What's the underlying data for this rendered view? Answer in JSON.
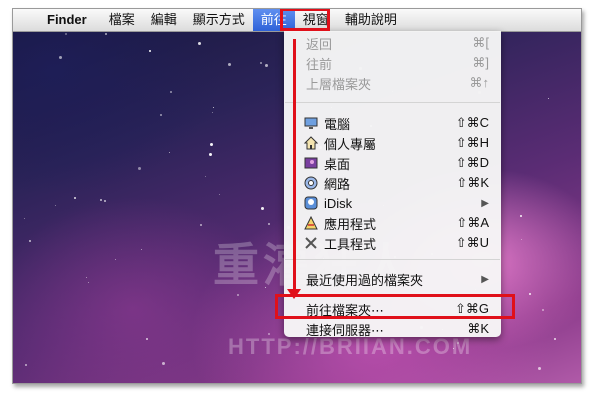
{
  "menubar": {
    "apple": "",
    "items": [
      "Finder",
      "檔案",
      "編輯",
      "顯示方式",
      "前往",
      "視窗",
      "輔助說明"
    ]
  },
  "menu": {
    "items": [
      {
        "label": "返回",
        "shortcut": "⌘[",
        "disabled": true,
        "icon": ""
      },
      {
        "label": "往前",
        "shortcut": "⌘]",
        "disabled": true,
        "icon": ""
      },
      {
        "label": "上層檔案夾",
        "shortcut": "⌘↑",
        "disabled": true,
        "icon": ""
      },
      {
        "label": "電腦",
        "shortcut": "⇧⌘C",
        "icon": "computer-icon"
      },
      {
        "label": "個人專屬",
        "shortcut": "⇧⌘H",
        "icon": "home-icon"
      },
      {
        "label": "桌面",
        "shortcut": "⇧⌘D",
        "icon": "desktop-icon"
      },
      {
        "label": "網路",
        "shortcut": "⇧⌘K",
        "icon": "network-icon"
      },
      {
        "label": "iDisk",
        "shortcut": "",
        "icon": "idisk-icon",
        "submenu": true
      },
      {
        "label": "應用程式",
        "shortcut": "⇧⌘A",
        "icon": "applications-icon"
      },
      {
        "label": "工具程式",
        "shortcut": "⇧⌘U",
        "icon": "utilities-icon"
      },
      {
        "label": "最近使用過的檔案夾",
        "shortcut": "",
        "submenu": true
      },
      {
        "label": "前往檔案夾⋯",
        "shortcut": "⇧⌘G"
      },
      {
        "label": "連接伺服器⋯",
        "shortcut": "⌘K"
      }
    ]
  },
  "watermark": {
    "main": "重灌狂人",
    "url": "HTTP://BRIIAN.COM"
  },
  "colors": {
    "highlight": "#2f62d8",
    "annotation": "#e0101a"
  }
}
